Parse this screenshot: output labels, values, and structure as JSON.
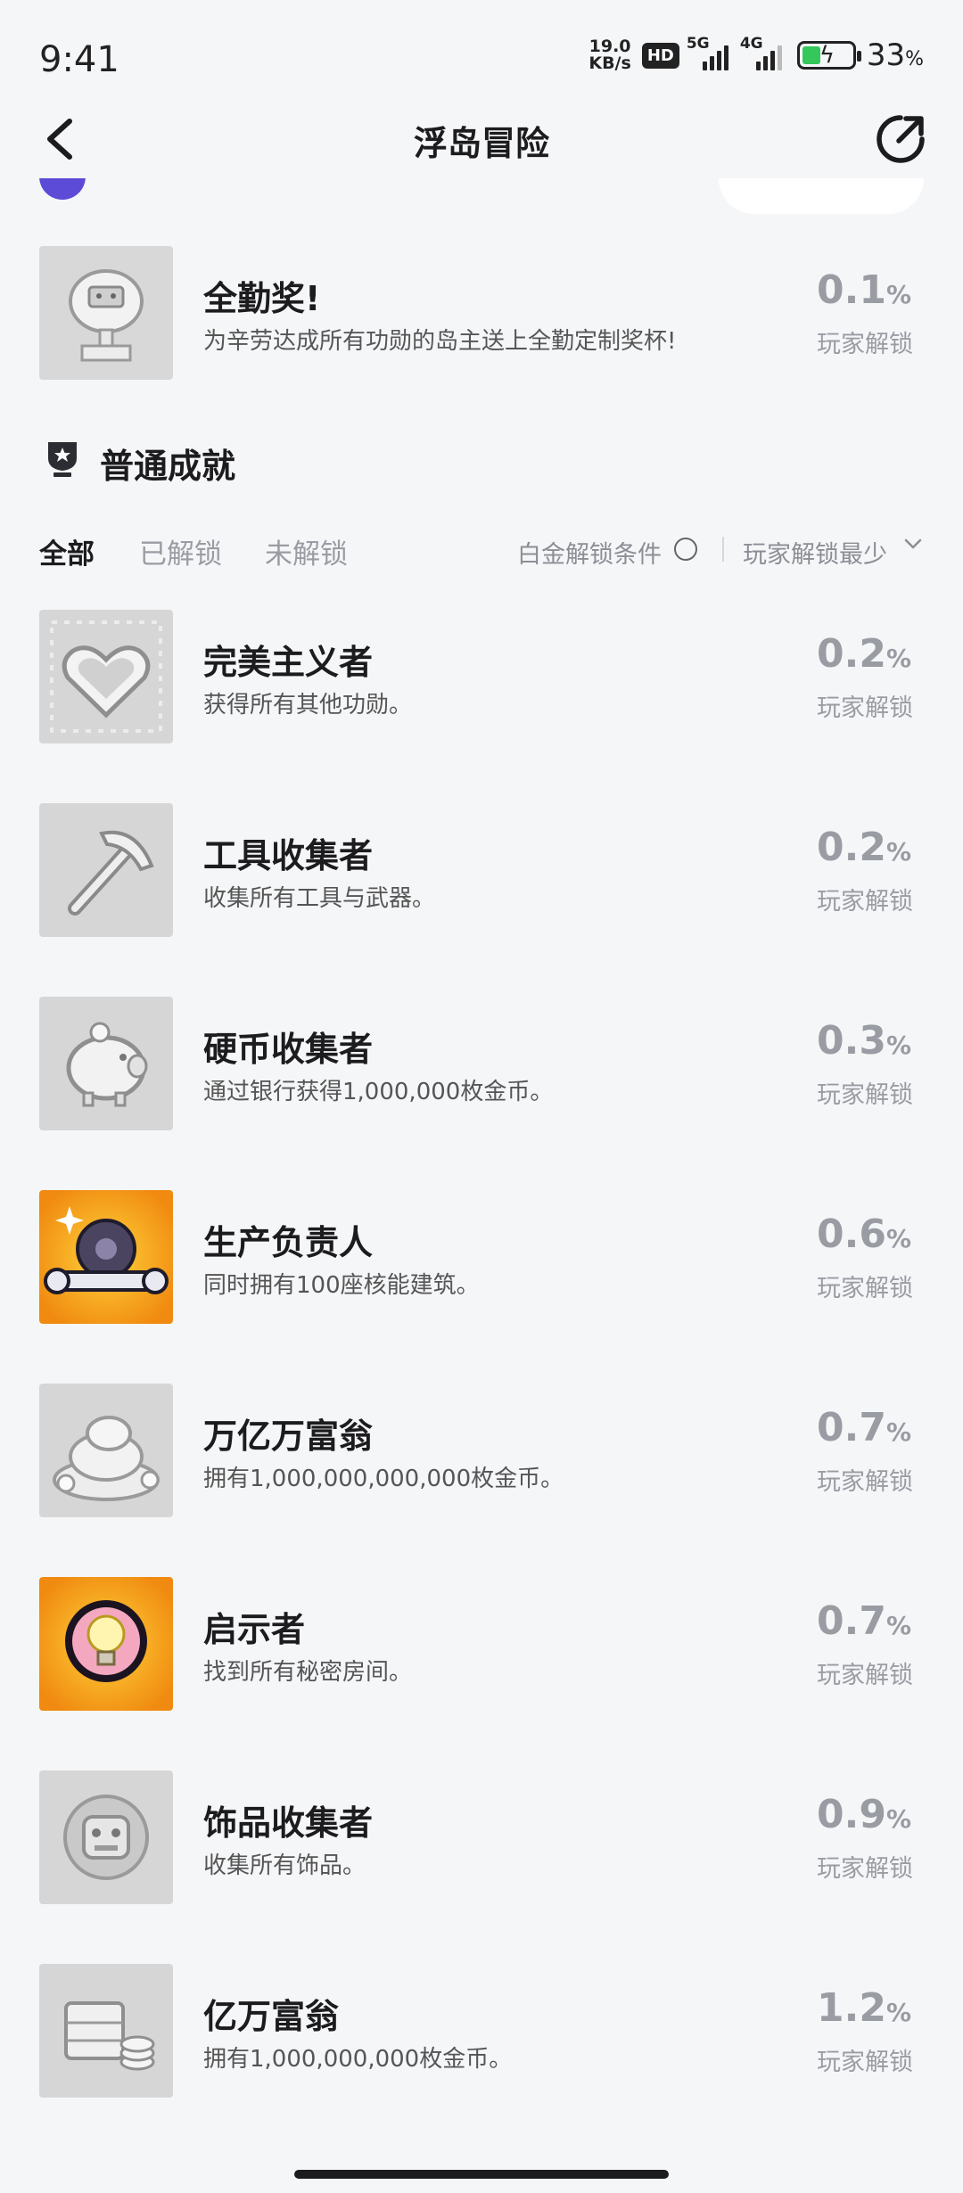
{
  "status": {
    "time": "9:41",
    "net_speed_value": "19.0",
    "net_speed_unit": "KB/s",
    "hd": "HD",
    "sig1": "5G",
    "sig2": "4G",
    "battery_value": "33",
    "battery_unit": "%"
  },
  "nav": {
    "title": "浮岛冒险"
  },
  "platinum": {
    "title": "全勤奖!",
    "desc": "为辛劳达成所有功勋的岛主送上全勤定制奖杯!",
    "pct": "0.1",
    "unit": "%",
    "label": "玩家解锁"
  },
  "section": {
    "title": "普通成就"
  },
  "filters": {
    "tabs": [
      "全部",
      "已解锁",
      "未解锁"
    ],
    "condition": "白金解锁条件",
    "sort": "玩家解锁最少"
  },
  "achievements": [
    {
      "title": "完美主义者",
      "desc": "获得所有其他功勋。",
      "pct": "0.2",
      "unit": "%",
      "label": "玩家解锁",
      "icon": "heart-trophy-icon"
    },
    {
      "title": "工具收集者",
      "desc": "收集所有工具与武器。",
      "pct": "0.2",
      "unit": "%",
      "label": "玩家解锁",
      "icon": "pickaxe-icon"
    },
    {
      "title": "硬币收集者",
      "desc": "通过银行获得1,000,000枚金币。",
      "pct": "0.3",
      "unit": "%",
      "label": "玩家解锁",
      "icon": "piggy-bank-icon"
    },
    {
      "title": "生产负责人",
      "desc": "同时拥有100座核能建筑。",
      "pct": "0.6",
      "unit": "%",
      "label": "玩家解锁",
      "icon": "gear-wrench-icon"
    },
    {
      "title": "万亿万富翁",
      "desc": "拥有1,000,000,000,000枚金币。",
      "pct": "0.7",
      "unit": "%",
      "label": "玩家解锁",
      "icon": "coin-pile-icon"
    },
    {
      "title": "启示者",
      "desc": "找到所有秘密房间。",
      "pct": "0.7",
      "unit": "%",
      "label": "玩家解锁",
      "icon": "lightbulb-icon"
    },
    {
      "title": "饰品收集者",
      "desc": "收集所有饰品。",
      "pct": "0.9",
      "unit": "%",
      "label": "玩家解锁",
      "icon": "trinket-icon"
    },
    {
      "title": "亿万富翁",
      "desc": "拥有1,000,000,000枚金币。",
      "pct": "1.2",
      "unit": "%",
      "label": "玩家解锁",
      "icon": "coin-stack-icon"
    }
  ],
  "colors": {
    "background": "#f5f6f8",
    "muted": "#9a9ca3",
    "badge_orange": "#f39a16",
    "platinum_purple": "#5b4bd6"
  }
}
